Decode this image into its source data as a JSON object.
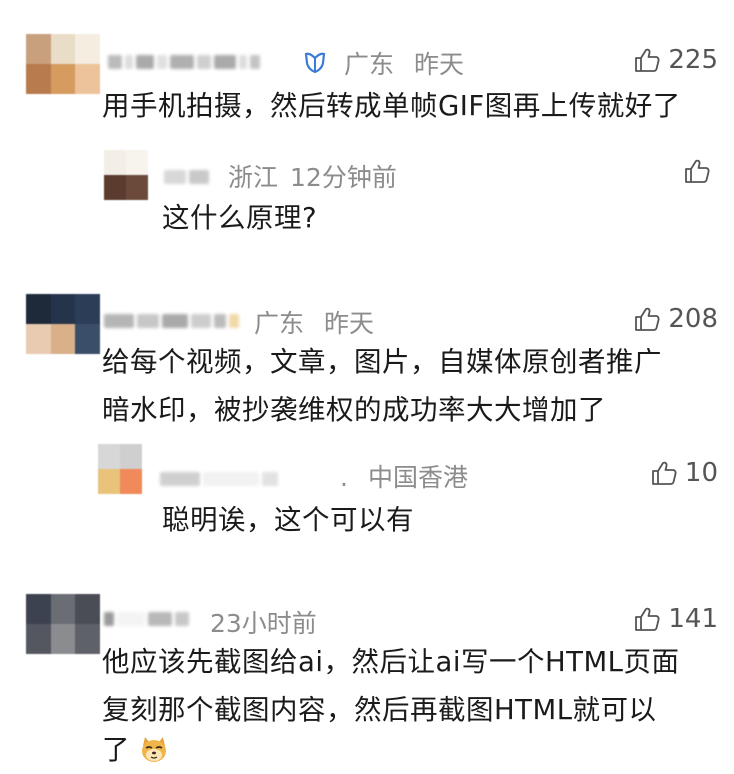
{
  "comments": [
    {
      "location": "广东",
      "time": "昨天",
      "likes": "225",
      "text": "用手机拍摄，然后转成单帧GIF图再上传就好了",
      "reply": {
        "location": "浙江",
        "time": "12分钟前",
        "likes": "",
        "text": "这什么原理?"
      }
    },
    {
      "location": "广东",
      "time": "昨天",
      "likes": "208",
      "text_lines": [
        "给每个视频，文章，图片，自媒体原创者推广",
        "暗水印，被抄袭维权的成功率大大增加了"
      ],
      "reply": {
        "location": "中国香港",
        "time": "",
        "likes": "10",
        "text": "聪明诶，这个可以有"
      }
    },
    {
      "location": "",
      "time": "23小时前",
      "likes": "141",
      "text_lines": [
        "他应该先截图给ai，然后让ai写一个HTML页面",
        "复刻那个截图内容，然后再截图HTML就可以",
        "了"
      ]
    }
  ],
  "icons": {
    "like": "thumbs-up-icon",
    "vip": "vip-badge-icon",
    "emoji": "doge-emoji-icon"
  },
  "colors": {
    "meta_gray": "#8c8c8c",
    "text": "#1a1a1a",
    "vip_blue": "#3a7bd5"
  }
}
